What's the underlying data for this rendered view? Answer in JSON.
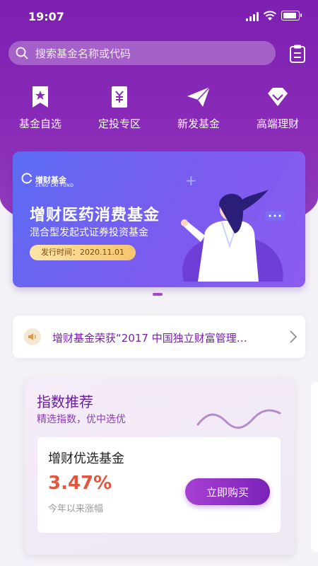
{
  "status": {
    "time": "19:07"
  },
  "search": {
    "placeholder": "搜索基金名称或代码"
  },
  "quick_nav": [
    {
      "label": "基金自选",
      "icon": "bookmark-star-icon"
    },
    {
      "label": "定投专区",
      "icon": "yen-ticket-icon"
    },
    {
      "label": "新发基金",
      "icon": "paper-plane-icon"
    },
    {
      "label": "高端理财",
      "icon": "diamond-icon"
    }
  ],
  "banner": {
    "logo": "增财基金",
    "logo_sub": "ZENG CAI FUND",
    "title": "增财医药消费基金",
    "subtitle": "混合型发起式证券投资基金",
    "date": "发行时间：2020.11.01"
  },
  "notice": {
    "text": "增财基金荣获“2017 中国独立财富管理…"
  },
  "recommend": {
    "title": "指数推荐",
    "subtitle": "精选指数，优中选优",
    "fund_name": "增财优选基金",
    "rate": "3.47%",
    "rate_label": "今年以来涨幅",
    "buy_label": "立即购买"
  },
  "colors": {
    "brand": "#7d1fb0",
    "accent_rate": "#e2563f"
  }
}
